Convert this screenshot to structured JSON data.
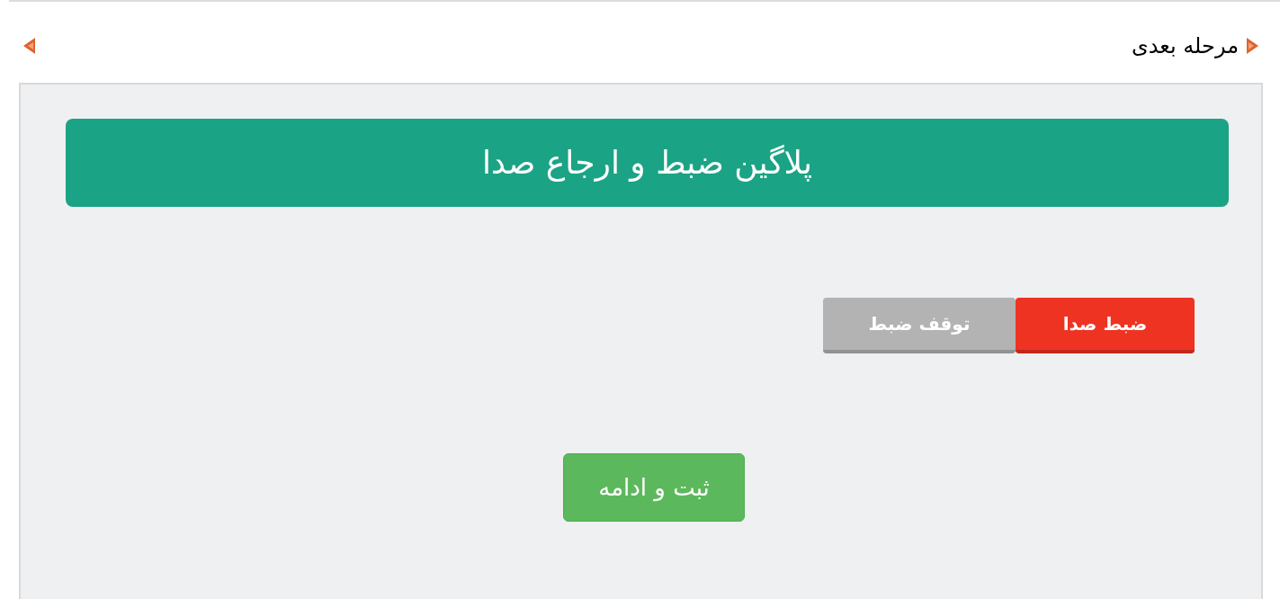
{
  "nav": {
    "next_label": "مرحله بعدی"
  },
  "panel": {
    "title": "پلاگین ضبط و ارجاع صدا",
    "controls": [
      {
        "label": "ضبط صدا",
        "kind": "record",
        "disabled": false
      },
      {
        "label": "توقف ضبط",
        "kind": "stop",
        "disabled": true
      }
    ],
    "submit": {
      "label": "ثبت و ادامه"
    }
  }
}
